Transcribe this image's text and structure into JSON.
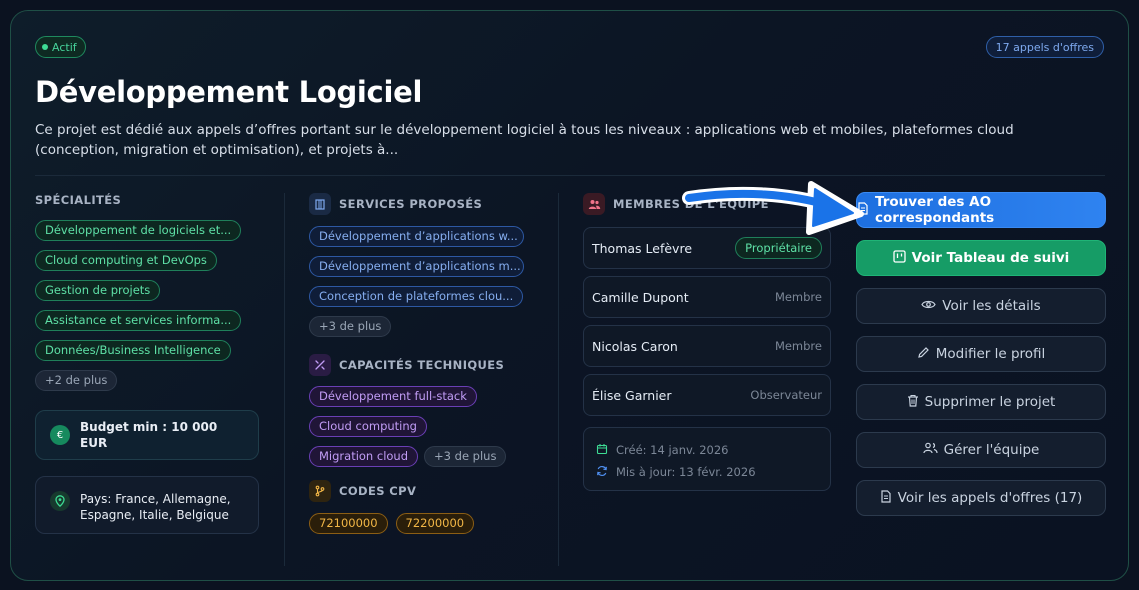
{
  "status_badge": "Actif",
  "tenders_count_badge": "17 appels d'offres",
  "title": "Développement Logiciel",
  "description": "Ce projet est dédié aux appels d’offres portant sur le développement logiciel à tous les niveaux : applications web et mobiles, plateformes cloud (conception, migration et optimisation), et projets à...",
  "specialites": {
    "label": "SPÉCIALITÉS",
    "items": [
      "Développement de logiciels et...",
      "Cloud computing et DevOps",
      "Gestion de projets",
      "Assistance et services informa...",
      "Données/Business Intelligence"
    ],
    "more": "+2 de plus"
  },
  "budget": "Budget min : 10 000 EUR",
  "pays": "Pays: France, Allemagne, Espagne, Italie, Belgique",
  "services": {
    "label": "SERVICES PROPOSÉS",
    "items": [
      "Développement d’applications w...",
      "Développement d’applications m...",
      "Conception de plateformes clou..."
    ],
    "more": "+3 de plus"
  },
  "capacites": {
    "label": "CAPACITÉS TECHNIQUES",
    "items": [
      "Développement full-stack",
      "Cloud computing",
      "Migration cloud"
    ],
    "more": "+3 de plus"
  },
  "cpv": {
    "label": "CODES CPV",
    "items": [
      "72100000",
      "72200000"
    ]
  },
  "membres": {
    "label": "MEMBRES DE L'ÉQUIPE",
    "items": [
      {
        "name": "Thomas Lefèvre",
        "role": "Propriétaire"
      },
      {
        "name": "Camille Dupont",
        "role": "Membre"
      },
      {
        "name": "Nicolas Caron",
        "role": "Membre"
      },
      {
        "name": "Élise Garnier",
        "role": "Observateur"
      }
    ]
  },
  "dates": {
    "created": "Créé: 14 janv. 2026",
    "updated": "Mis à jour: 13 févr. 2026"
  },
  "actions": {
    "find": "Trouver des AO correspondants",
    "tracking": "Voir Tableau de suivi",
    "details": "Voir les détails",
    "edit": "Modifier le profil",
    "delete": "Supprimer le projet",
    "team": "Gérer l'équipe",
    "tenders": "Voir les appels d'offres (17)"
  },
  "colors": {
    "accent_green": "#169c66",
    "accent_blue": "#2f83f0",
    "background": "#0b1220"
  }
}
